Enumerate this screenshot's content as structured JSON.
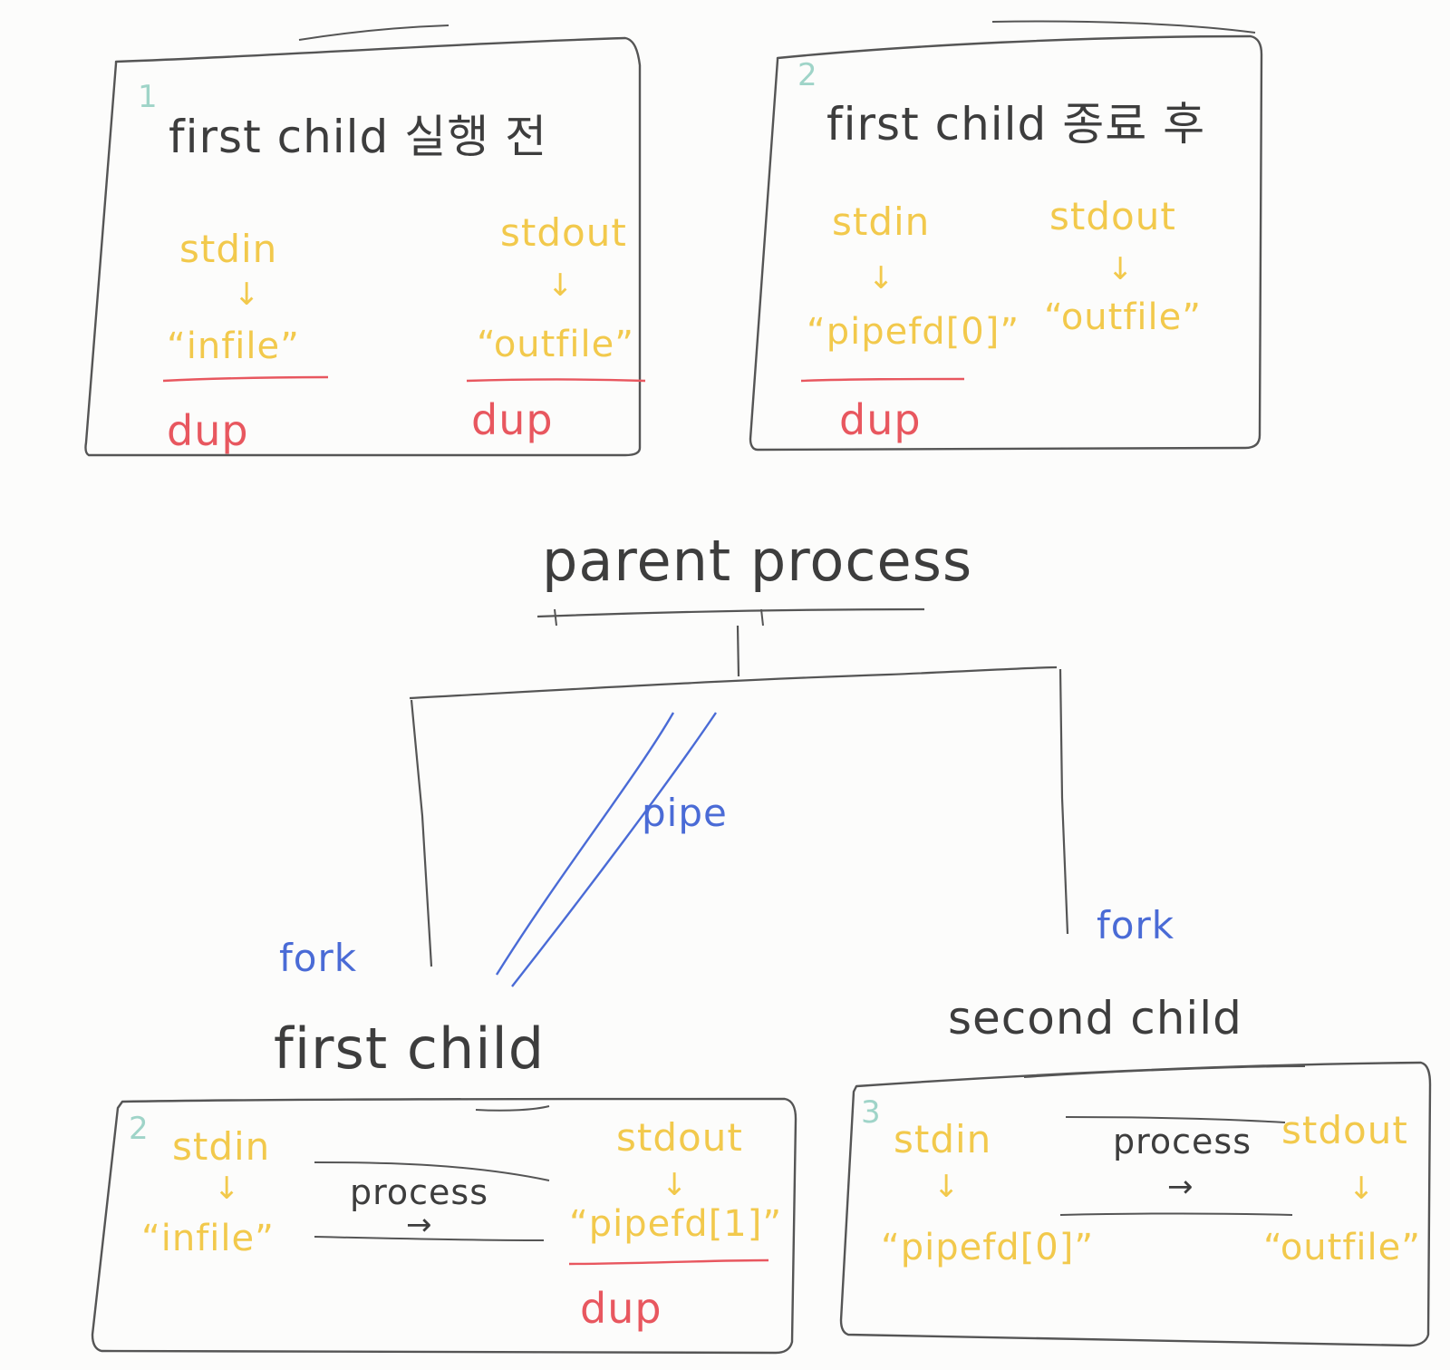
{
  "colors": {
    "ink": "#3d3d3d",
    "stream": "#f2c94c",
    "dup": "#e8575f",
    "fork_pipe": "#4a6bd6",
    "step_number": "#9fd4c8"
  },
  "boxes": {
    "box1": {
      "number": "1",
      "title": "first child 실행 전",
      "stdin_label": "stdin",
      "stdin_arrow": "↓",
      "stdin_target": "“infile”",
      "stdin_dup": "dup",
      "stdout_label": "stdout",
      "stdout_arrow": "↓",
      "stdout_target": "“outfile”",
      "stdout_dup": "dup"
    },
    "box2": {
      "number": "2",
      "title": "first child 종료 후",
      "stdin_label": "stdin",
      "stdin_arrow": "↓",
      "stdin_target": "“pipefd[0]”",
      "stdin_dup": "dup",
      "stdout_label": "stdout",
      "stdout_arrow": "↓",
      "stdout_target": "“outfile”"
    },
    "first_child_box": {
      "number": "2",
      "stdin_label": "stdin",
      "stdin_arrow": "↓",
      "stdin_target": "“infile”",
      "process_label": "process",
      "process_arrow": "→",
      "stdout_label": "stdout",
      "stdout_arrow": "↓",
      "stdout_target": "“pipefd[1]”",
      "stdout_dup": "dup"
    },
    "second_child_box": {
      "number": "3",
      "stdin_label": "stdin",
      "stdin_arrow": "↓",
      "stdin_target": "“pipefd[0]”",
      "process_label": "process",
      "process_arrow": "→",
      "stdout_label": "stdout",
      "stdout_arrow": "↓",
      "stdout_target": "“outfile”"
    }
  },
  "tree": {
    "parent": "parent process",
    "pipe_label": "pipe",
    "left_fork": "fork",
    "right_fork": "fork",
    "first_child": "first child",
    "second_child": "second child"
  }
}
